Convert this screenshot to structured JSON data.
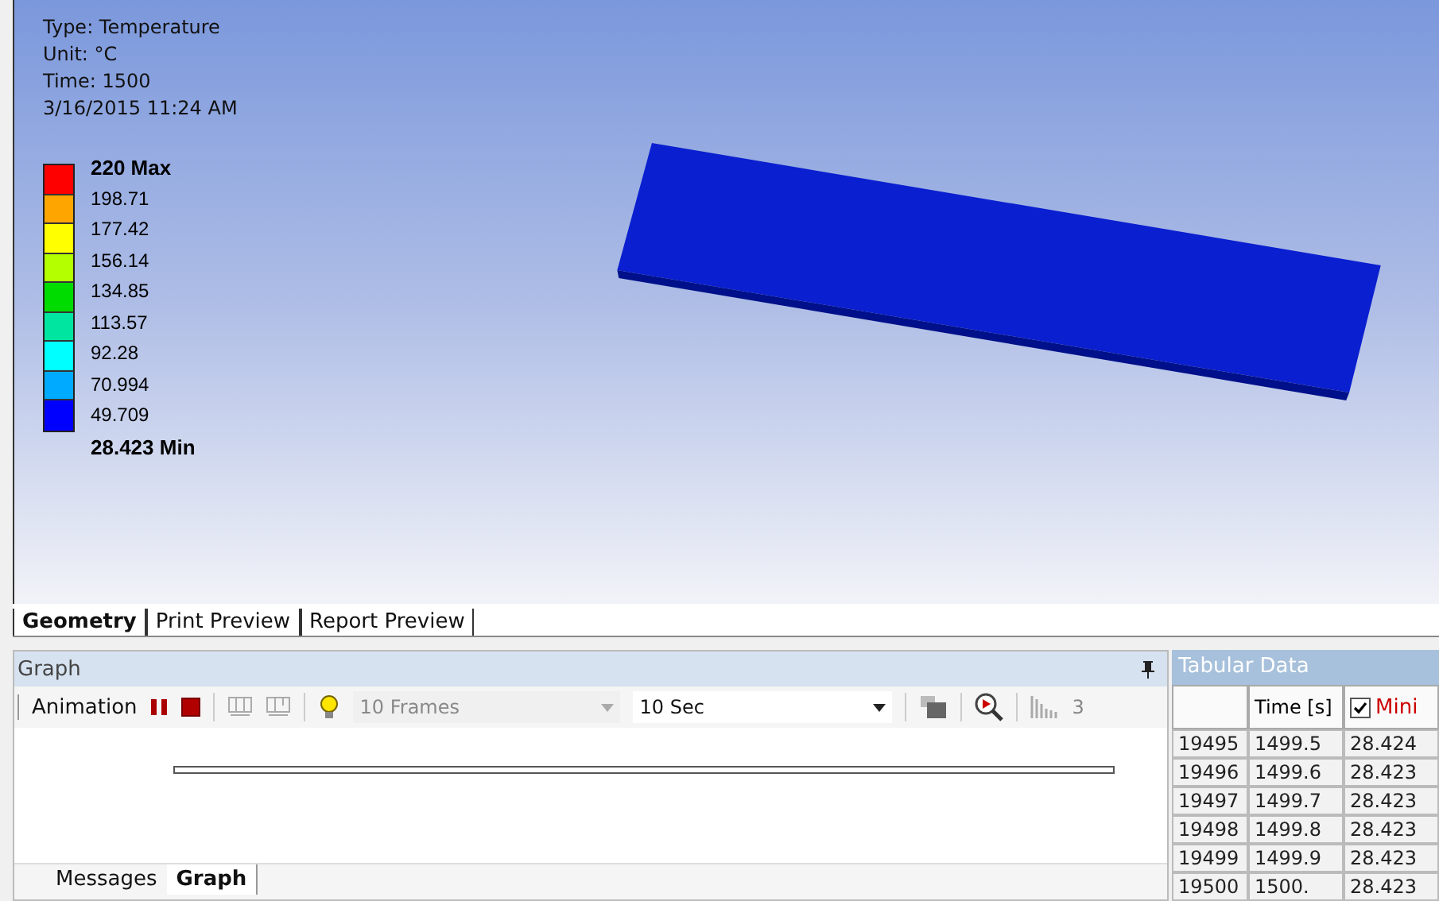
{
  "viewport": {
    "info": [
      "Type: Temperature",
      "Unit: °C",
      "Time: 1500",
      "3/16/2015 11:24 AM"
    ],
    "legend": {
      "labels": [
        "220 Max",
        "198.71",
        "177.42",
        "156.14",
        "134.85",
        "113.57",
        "92.28",
        "70.994",
        "49.709",
        "28.423 Min"
      ],
      "bands": [
        {
          "color": "#ff0000"
        },
        {
          "color": "#ffa500"
        },
        {
          "color": "#ffff00"
        },
        {
          "color": "#b4ff00"
        },
        {
          "color": "#00dc00"
        },
        {
          "color": "#00e6a0"
        },
        {
          "color": "#00ffff"
        },
        {
          "color": "#00aaff"
        },
        {
          "color": "#0000ff"
        }
      ]
    }
  },
  "view_tabs": [
    {
      "label": "Geometry",
      "selected": true
    },
    {
      "label": "Print Preview",
      "selected": false
    },
    {
      "label": "Report Preview",
      "selected": false
    }
  ],
  "graph_panel": {
    "title": "Graph",
    "toolbar": {
      "label": "Animation",
      "frames": {
        "value": "10 Frames",
        "disabled": true
      },
      "duration": {
        "value": "10 Sec",
        "disabled": false
      },
      "count": "3"
    },
    "bottom_tabs": [
      {
        "label": "Messages",
        "selected": false
      },
      {
        "label": "Graph",
        "selected": true
      }
    ]
  },
  "tabular_data": {
    "title": "Tabular Data",
    "time_header": "Time [s]",
    "value_header": {
      "label": "Mini",
      "checked": true
    },
    "rows": [
      [
        "19495",
        "1499.5",
        "28.424"
      ],
      [
        "19496",
        "1499.6",
        "28.423"
      ],
      [
        "19497",
        "1499.7",
        "28.423"
      ],
      [
        "19498",
        "1499.8",
        "28.423"
      ],
      [
        "19499",
        "1499.9",
        "28.423"
      ],
      [
        "19500",
        "1500.",
        "28.423"
      ]
    ]
  }
}
